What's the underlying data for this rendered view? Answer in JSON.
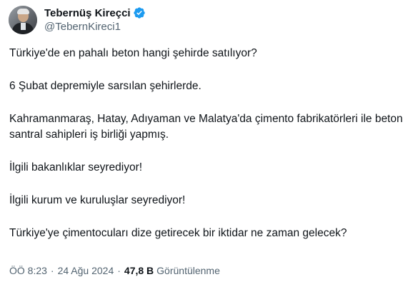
{
  "author": {
    "display_name": "Tebernüş Kireçci",
    "handle": "@TebernKireci1",
    "verified": true,
    "verified_color": "#1d9bf0"
  },
  "tweet": {
    "paragraphs": [
      "Türkiye'de en pahalı beton hangi şehirde satılıyor?",
      "6 Şubat depremiyle sarsılan şehirlerde.",
      "Kahramanmaraş, Hatay, Adıyaman ve Malatya'da çimento fabrikatörleri ile beton santral sahipleri iş birliği yapmış.",
      "İlgili bakanlıklar seyrediyor!",
      "İlgili kurum ve kuruluşlar seyrediyor!",
      "Türkiye'ye çimentocuları dize getirecek bir iktidar ne zaman gelecek?"
    ]
  },
  "meta": {
    "time": "ÖÖ 8:23",
    "separator": "·",
    "date": "24 Ağu 2024",
    "views_count": "47,8 B",
    "views_label": "Görüntülenme"
  }
}
